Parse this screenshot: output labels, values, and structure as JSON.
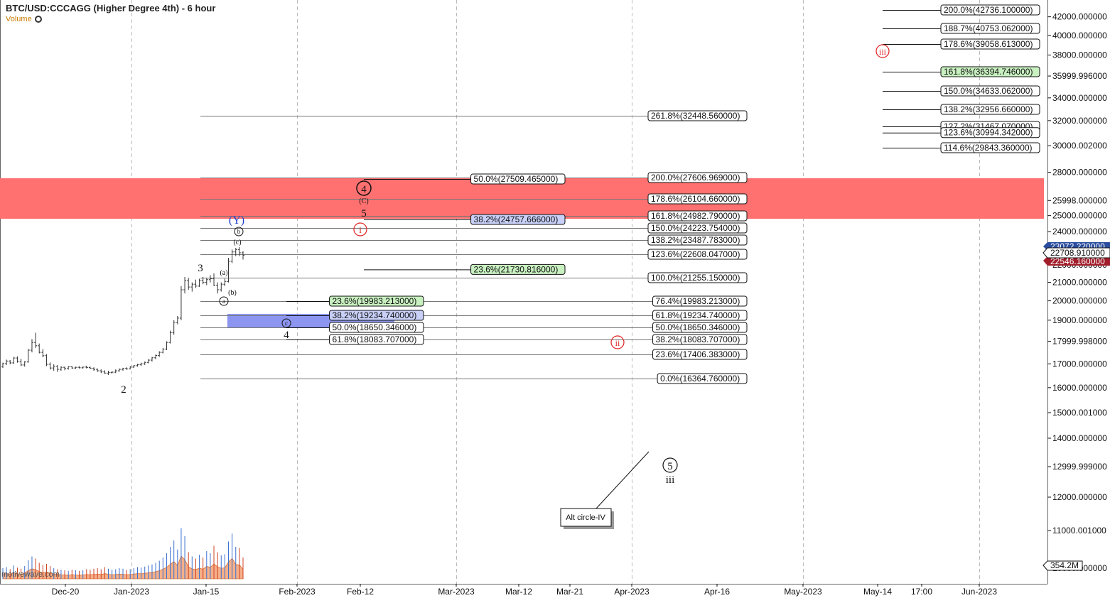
{
  "header": {
    "title": "BTC/USD:CCCAGG (Higher Degree 4th) - 6 hour",
    "volume_label": "Volume"
  },
  "watermark": "motivewave.com",
  "colors": {
    "resistance_zone": "#ff7070",
    "support_zone": "#8c96f0",
    "fib_green": "#c8f0c0",
    "fib_blue": "#c8d0f8",
    "candle": "#333333",
    "volume_up": "#3a6fd0",
    "volume_down": "#d04020",
    "volume_area": "#f5b08a"
  },
  "chart_data": {
    "type": "candlestick",
    "y_axis_ticks": [
      "42000.000000",
      "40000.000000",
      "38000.000000",
      "35999.996000",
      "34000.000000",
      "32000.000000",
      "30000.002000",
      "28000.000000",
      "25998.000000",
      "25000.000000",
      "24000.000000",
      "23000.000000",
      "22000.000000",
      "21000.000000",
      "20000.000000",
      "19000.000000",
      "17999.998000",
      "17000.000000",
      "16000.000000",
      "15000.001000",
      "14000.000000",
      "12999.999000",
      "12000.000000",
      "11000.001000",
      "10000.000000"
    ],
    "x_axis_ticks": [
      "Dec-20",
      "Jan-2023",
      "Jan-15",
      "Feb-2023",
      "Feb-12",
      "Mar-2023",
      "Mar-12",
      "Mar-21",
      "Apr-2023",
      "Apr-16",
      "May-2023",
      "May-14",
      "17:00",
      "Jun-2023"
    ],
    "price_labels": [
      "23072.220000",
      "22708.910000",
      "22546.160000"
    ],
    "volume_label": "354.2M",
    "fib_top_right": [
      "200.0%(42736.100000)",
      "188.7%(40753.062000)",
      "178.6%(39058.613000)",
      "161.8%(36394.746000)",
      "150.0%(34633.062000)",
      "138.2%(32956.660000)",
      "127.2%(31467.070000)",
      "123.6%(30994.342000)",
      "114.6%(29843.360000)"
    ],
    "fib_extension": [
      "261.8%(32448.560000)",
      "200.0%(27606.969000)",
      "178.6%(26104.660000)",
      "161.8%(24982.790000)",
      "150.0%(24223.754000)",
      "138.2%(23487.783000)",
      "123.6%(22608.047000)",
      "100.0%(21255.150000)",
      "76.4%(19983.213000)",
      "61.8%(19234.740000)",
      "50.0%(18650.346000)",
      "38.2%(18083.707000)",
      "23.6%(17406.383000)",
      "0.0%(16364.760000)"
    ],
    "fib_mid": [
      "50.0%(27509.465000)",
      "38.2%(24757.666000)",
      "23.6%(21730.816000)"
    ],
    "fib_retrace": [
      "23.6%(19983.213000)",
      "38.2%(19234.740000)",
      "50.0%(18650.346000)",
      "61.8%(18083.707000)"
    ],
    "wave_labels": [
      "2",
      "3",
      "4",
      "5",
      "(Y)",
      "(C)",
      "a",
      "b",
      "c",
      "(a)",
      "(b)",
      "(c)",
      "4",
      "5",
      "i",
      "ii",
      "iii",
      "iii"
    ],
    "annotation": "Alt circle-IV",
    "candles": [
      [
        16900,
        17050,
        16820,
        17010
      ],
      [
        17010,
        17180,
        16950,
        17120
      ],
      [
        17120,
        17160,
        16980,
        17040
      ],
      [
        17040,
        17300,
        17000,
        17250
      ],
      [
        17250,
        17320,
        17050,
        17100
      ],
      [
        17100,
        17220,
        16900,
        16950
      ],
      [
        16950,
        17120,
        16880,
        17080
      ],
      [
        17080,
        17650,
        17050,
        17600
      ],
      [
        17600,
        18100,
        17500,
        17950
      ],
      [
        17950,
        18400,
        17700,
        17800
      ],
      [
        17800,
        17900,
        17450,
        17500
      ],
      [
        17500,
        17650,
        17280,
        17350
      ],
      [
        17350,
        17420,
        16900,
        16980
      ],
      [
        16980,
        17060,
        16750,
        16820
      ],
      [
        16820,
        16980,
        16700,
        16900
      ],
      [
        16900,
        16950,
        16650,
        16760
      ],
      [
        16760,
        16900,
        16700,
        16850
      ],
      [
        16850,
        16880,
        16720,
        16800
      ],
      [
        16800,
        16900,
        16750,
        16870
      ],
      [
        16870,
        16900,
        16780,
        16820
      ],
      [
        16820,
        16880,
        16780,
        16850
      ],
      [
        16850,
        16900,
        16800,
        16830
      ],
      [
        16830,
        16880,
        16790,
        16860
      ],
      [
        16860,
        16920,
        16800,
        16840
      ],
      [
        16840,
        16880,
        16780,
        16800
      ],
      [
        16800,
        16850,
        16700,
        16760
      ],
      [
        16760,
        16800,
        16650,
        16700
      ],
      [
        16700,
        16760,
        16600,
        16650
      ],
      [
        16650,
        16720,
        16560,
        16600
      ],
      [
        16600,
        16700,
        16520,
        16620
      ],
      [
        16620,
        16680,
        16580,
        16640
      ],
      [
        16640,
        16760,
        16600,
        16700
      ],
      [
        16700,
        16800,
        16660,
        16760
      ],
      [
        16760,
        16830,
        16700,
        16800
      ],
      [
        16800,
        16850,
        16740,
        16780
      ],
      [
        16780,
        16900,
        16760,
        16860
      ],
      [
        16860,
        16950,
        16820,
        16920
      ],
      [
        16920,
        17000,
        16880,
        16960
      ],
      [
        16960,
        17050,
        16900,
        17000
      ],
      [
        17000,
        17100,
        16950,
        17060
      ],
      [
        17060,
        17200,
        17020,
        17160
      ],
      [
        17160,
        17300,
        17100,
        17260
      ],
      [
        17260,
        17400,
        17200,
        17360
      ],
      [
        17360,
        17550,
        17300,
        17500
      ],
      [
        17500,
        17700,
        17450,
        17650
      ],
      [
        17650,
        18000,
        17600,
        17950
      ],
      [
        17950,
        18500,
        17900,
        18400
      ],
      [
        18400,
        19000,
        18300,
        18900
      ],
      [
        18900,
        19200,
        18800,
        19100
      ],
      [
        19100,
        20800,
        19000,
        20600
      ],
      [
        20600,
        21300,
        20400,
        21100
      ],
      [
        21100,
        21250,
        20600,
        20750
      ],
      [
        20750,
        21000,
        20500,
        20900
      ],
      [
        20900,
        21150,
        20700,
        20800
      ],
      [
        20800,
        21200,
        20750,
        21100
      ],
      [
        21100,
        21300,
        20900,
        21000
      ],
      [
        21000,
        21250,
        20850,
        21150
      ],
      [
        21150,
        21400,
        21000,
        21200
      ],
      [
        21200,
        21500,
        20800,
        20850
      ],
      [
        20850,
        21000,
        20400,
        20600
      ],
      [
        20600,
        21000,
        20500,
        20900
      ],
      [
        20900,
        21200,
        20800,
        21050
      ],
      [
        21050,
        22400,
        21000,
        22200
      ],
      [
        22200,
        22900,
        22100,
        22750
      ],
      [
        22750,
        23000,
        22500,
        22900
      ],
      [
        22900,
        23050,
        22500,
        22700
      ],
      [
        22700,
        22800,
        22300,
        22550
      ]
    ],
    "volumes": [
      0.2,
      0.22,
      0.18,
      0.25,
      0.21,
      0.19,
      0.24,
      0.35,
      0.42,
      0.38,
      0.3,
      0.26,
      0.28,
      0.24,
      0.2,
      0.18,
      0.17,
      0.16,
      0.15,
      0.17,
      0.16,
      0.15,
      0.16,
      0.18,
      0.17,
      0.19,
      0.2,
      0.18,
      0.22,
      0.19,
      0.17,
      0.18,
      0.2,
      0.19,
      0.17,
      0.18,
      0.2,
      0.22,
      0.21,
      0.23,
      0.25,
      0.27,
      0.3,
      0.34,
      0.4,
      0.48,
      0.6,
      0.72,
      0.55,
      0.95,
      0.8,
      0.5,
      0.42,
      0.38,
      0.45,
      0.4,
      0.52,
      0.48,
      0.62,
      0.5,
      0.44,
      0.46,
      0.7,
      0.85,
      0.6,
      0.58,
      0.4
    ]
  }
}
